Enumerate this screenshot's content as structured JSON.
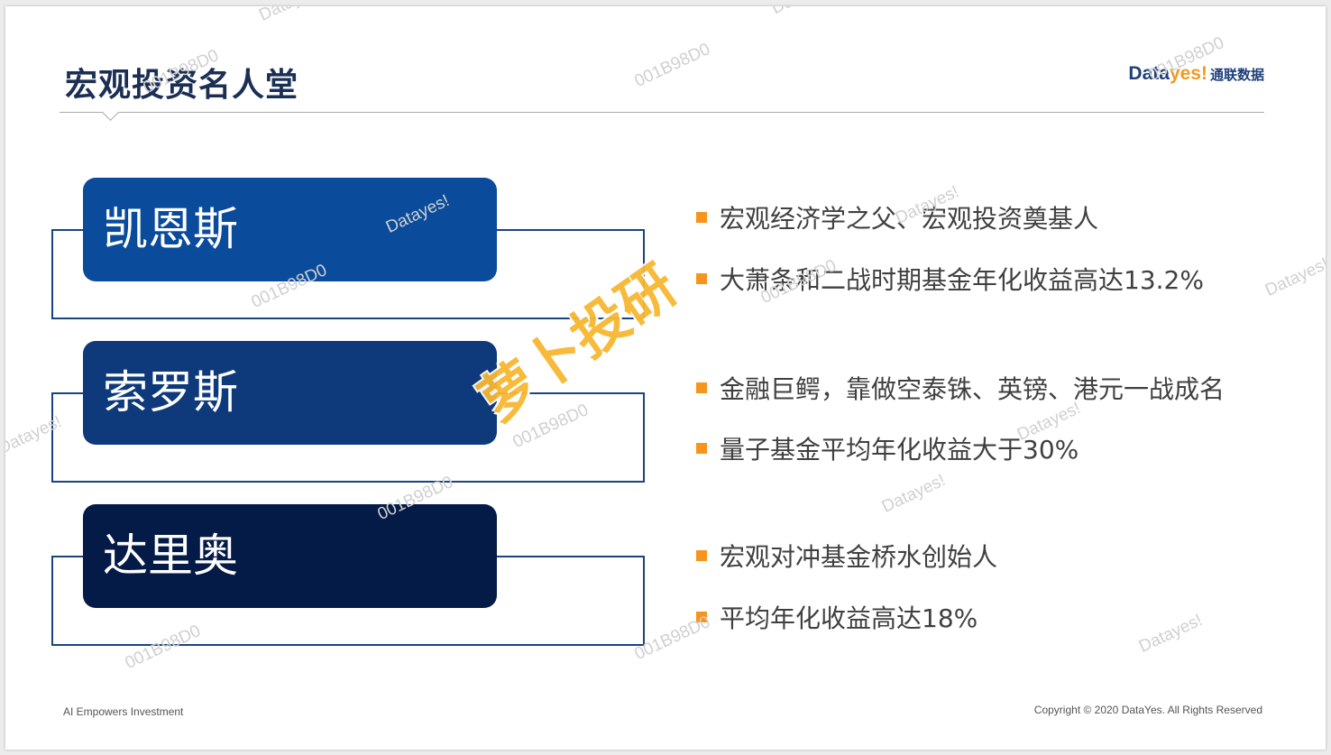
{
  "title": "宏观投资名人堂",
  "logo": {
    "brand_part1": "Data",
    "brand_part2": "yes!",
    "cn": "通联数据"
  },
  "investors": [
    {
      "name": "凯恩斯",
      "color": "#0a4b9b",
      "points": [
        "宏观经济学之父、宏观投资奠基人",
        "大萧条和二战时期基金年化收益高达13.2%"
      ]
    },
    {
      "name": "索罗斯",
      "color": "#0e3a7c",
      "points": [
        "金融巨鳄，靠做空泰铢、英镑、港元一战成名",
        "量子基金平均年化收益大于30%"
      ]
    },
    {
      "name": "达里奥",
      "color": "#041a47",
      "points": [
        "宏观对冲基金桥水创始人",
        "平均年化收益高达18%"
      ]
    }
  ],
  "stamp": "萝卜投研",
  "watermarks": [
    "Dataye",
    "Da",
    "001B98D0",
    "001B98D0",
    "001B98D0",
    "Datayes!",
    "Datayes!",
    "001B98D0",
    "001B98D0",
    "Datayes!",
    "Datayes!",
    "001B98D0",
    "Datayes!",
    "001B98D0",
    "Datayes!",
    "001B98D0",
    "001B98D0",
    "Datayes!"
  ],
  "footer": {
    "left": "AI Empowers Investment",
    "right": "Copyright © 2020 DataYes. All Rights Reserved"
  },
  "colors": {
    "accent": "#f7941d",
    "title": "#1b2f55",
    "frame": "#1a4480"
  }
}
